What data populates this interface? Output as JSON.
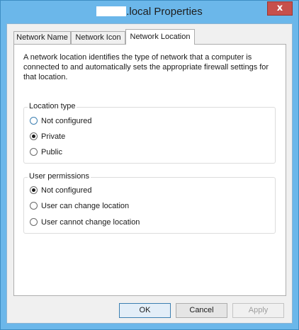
{
  "window": {
    "title_suffix": ".local Properties",
    "close_glyph": "x"
  },
  "tabs": [
    {
      "label": "Network Name",
      "active": false
    },
    {
      "label": "Network Icon",
      "active": false
    },
    {
      "label": "Network Location",
      "active": true
    }
  ],
  "panel": {
    "description_lines": [
      "A network location identifies the type of network that a computer is",
      "connected to and automatically sets the appropriate firewall settings for",
      "that location."
    ],
    "location_type": {
      "label": "Location type",
      "options": [
        {
          "label": "Not configured",
          "selected": false
        },
        {
          "label": "Private",
          "selected": true
        },
        {
          "label": "Public",
          "selected": false
        }
      ]
    },
    "user_permissions": {
      "label": "User permissions",
      "options": [
        {
          "label": "Not configured",
          "selected": true
        },
        {
          "label": "User can change location",
          "selected": false
        },
        {
          "label": "User cannot change location",
          "selected": false
        }
      ]
    }
  },
  "buttons": {
    "ok": "OK",
    "cancel": "Cancel",
    "apply": "Apply"
  }
}
